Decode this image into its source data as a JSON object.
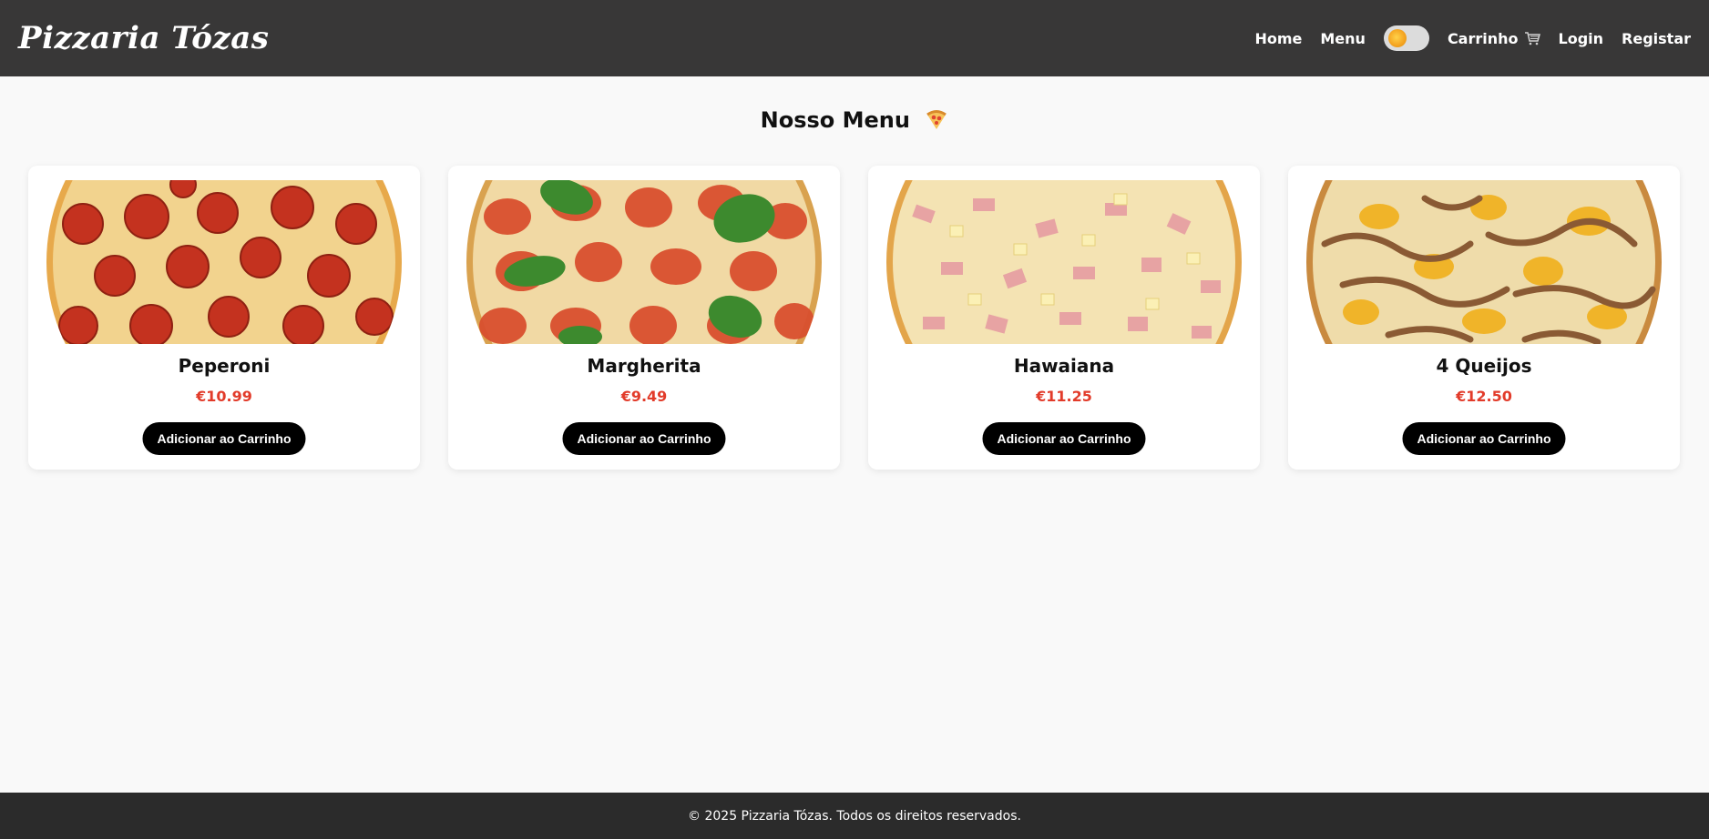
{
  "header": {
    "logo": "Pizzaria Tózas",
    "nav": {
      "home": "Home",
      "menu": "Menu",
      "cart": "Carrinho",
      "login": "Login",
      "register": "Registar"
    },
    "theme_toggle": {
      "state": "light",
      "knob_icon": "sun-icon"
    },
    "cart_icon": "cart-icon"
  },
  "main": {
    "title": "Nosso Menu",
    "title_icon": "pizza-slice-icon",
    "products": [
      {
        "name": "Peperoni",
        "price": "€10.99",
        "button": "Adicionar ao Carrinho",
        "image": "pepperoni-pizza"
      },
      {
        "name": "Margherita",
        "price": "€9.49",
        "button": "Adicionar ao Carrinho",
        "image": "margherita-pizza"
      },
      {
        "name": "Hawaiana",
        "price": "€11.25",
        "button": "Adicionar ao Carrinho",
        "image": "hawaiian-pizza"
      },
      {
        "name": "4 Queijos",
        "price": "€12.50",
        "button": "Adicionar ao Carrinho",
        "image": "four-cheese-pizza"
      }
    ]
  },
  "footer": {
    "text": "© 2025 Pizzaria Tózas. Todos os direitos reservados."
  },
  "colors": {
    "header_bg": "#383737",
    "footer_bg": "#2b2b2b",
    "page_bg": "#f9f9f9",
    "price": "#e23b2a",
    "button_bg": "#000000"
  }
}
